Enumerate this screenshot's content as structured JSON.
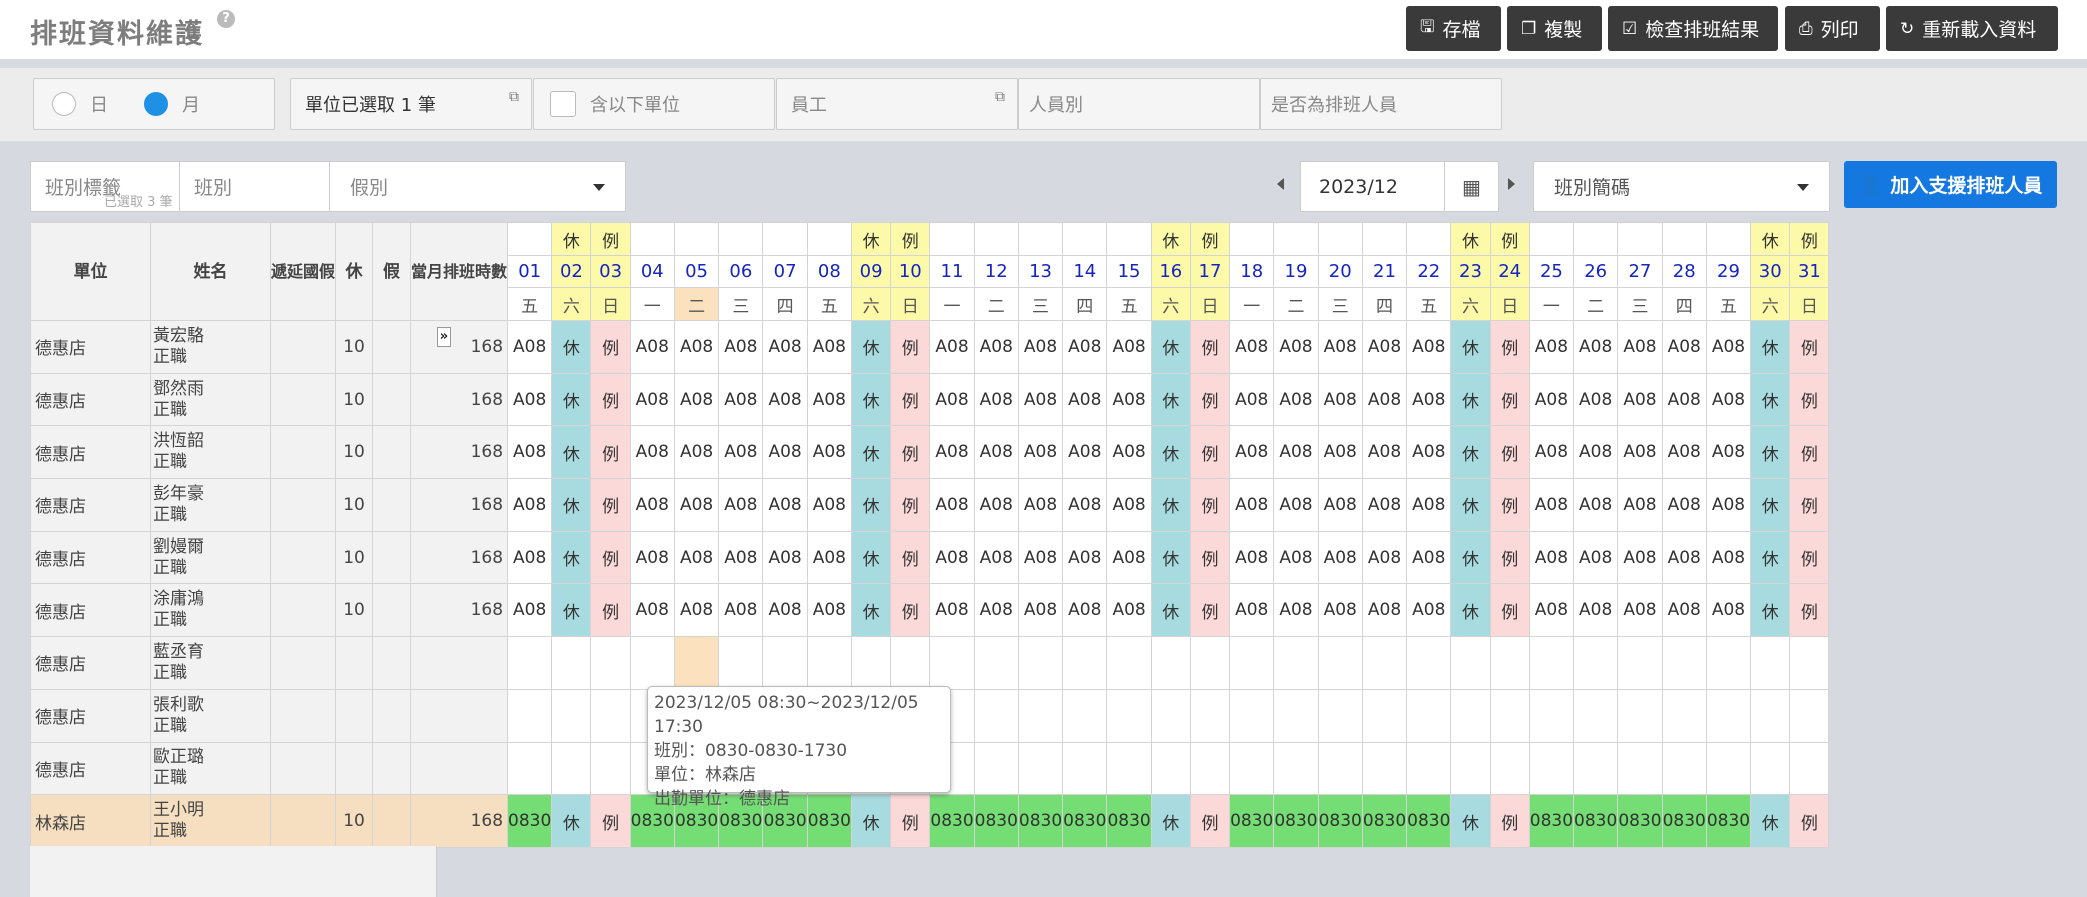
{
  "header": {
    "title": "排班資料維護",
    "help": "?",
    "buttons": [
      {
        "label": "存檔",
        "icon": "save-icon"
      },
      {
        "label": "複製",
        "icon": "copy-icon"
      },
      {
        "label": "檢查排班結果",
        "icon": "check-icon"
      },
      {
        "label": "列印",
        "icon": "print-icon"
      },
      {
        "label": "重新載入資料",
        "icon": "reload-icon"
      }
    ]
  },
  "filters": {
    "mode_day": "日",
    "mode_month": "月",
    "selected_mode": "月",
    "unit_selected": "單位已選取 1 筆",
    "include_sub_units": "含以下單位",
    "employee": "員工",
    "staff_type": "人員別",
    "is_scheduler": "是否為排班人員"
  },
  "grid_filters": {
    "shift_tag": "班別標籤",
    "shift_tag_count": "已選取 3 筆",
    "shift": "班別",
    "leave": "假別",
    "month": "2023/12",
    "shift_code": "班別簡碼",
    "add_support": "加入支援排班人員"
  },
  "table": {
    "headers": {
      "unit": "單位",
      "name": "姓名",
      "deferred": "遞延國假",
      "rest": "休",
      "leave": "假",
      "hours": "當月排班時數"
    },
    "days": [
      {
        "d": "01",
        "w": "五",
        "top": ""
      },
      {
        "d": "02",
        "w": "六",
        "top": "休"
      },
      {
        "d": "03",
        "w": "日",
        "top": "例"
      },
      {
        "d": "04",
        "w": "一",
        "top": ""
      },
      {
        "d": "05",
        "w": "二",
        "top": ""
      },
      {
        "d": "06",
        "w": "三",
        "top": ""
      },
      {
        "d": "07",
        "w": "四",
        "top": ""
      },
      {
        "d": "08",
        "w": "五",
        "top": ""
      },
      {
        "d": "09",
        "w": "六",
        "top": "休"
      },
      {
        "d": "10",
        "w": "日",
        "top": "例"
      },
      {
        "d": "11",
        "w": "一",
        "top": ""
      },
      {
        "d": "12",
        "w": "二",
        "top": ""
      },
      {
        "d": "13",
        "w": "三",
        "top": ""
      },
      {
        "d": "14",
        "w": "四",
        "top": ""
      },
      {
        "d": "15",
        "w": "五",
        "top": ""
      },
      {
        "d": "16",
        "w": "六",
        "top": "休"
      },
      {
        "d": "17",
        "w": "日",
        "top": "例"
      },
      {
        "d": "18",
        "w": "一",
        "top": ""
      },
      {
        "d": "19",
        "w": "二",
        "top": ""
      },
      {
        "d": "20",
        "w": "三",
        "top": ""
      },
      {
        "d": "21",
        "w": "四",
        "top": ""
      },
      {
        "d": "22",
        "w": "五",
        "top": ""
      },
      {
        "d": "23",
        "w": "六",
        "top": "休"
      },
      {
        "d": "24",
        "w": "日",
        "top": "例"
      },
      {
        "d": "25",
        "w": "一",
        "top": ""
      },
      {
        "d": "26",
        "w": "二",
        "top": ""
      },
      {
        "d": "27",
        "w": "三",
        "top": ""
      },
      {
        "d": "28",
        "w": "四",
        "top": ""
      },
      {
        "d": "29",
        "w": "五",
        "top": ""
      },
      {
        "d": "30",
        "w": "六",
        "top": "休"
      },
      {
        "d": "31",
        "w": "日",
        "top": "例"
      }
    ],
    "rows": [
      {
        "unit": "德惠店",
        "name": "黃宏駱",
        "title": "正職",
        "deferred": "",
        "rest": "10",
        "leave": "",
        "hours": "168",
        "shift": "A08"
      },
      {
        "unit": "德惠店",
        "name": "鄧然雨",
        "title": "正職",
        "deferred": "",
        "rest": "10",
        "leave": "",
        "hours": "168",
        "shift": "A08"
      },
      {
        "unit": "德惠店",
        "name": "洪恆韶",
        "title": "正職",
        "deferred": "",
        "rest": "10",
        "leave": "",
        "hours": "168",
        "shift": "A08"
      },
      {
        "unit": "德惠店",
        "name": "彭年豪",
        "title": "正職",
        "deferred": "",
        "rest": "10",
        "leave": "",
        "hours": "168",
        "shift": "A08"
      },
      {
        "unit": "德惠店",
        "name": "劉嫚爾",
        "title": "正職",
        "deferred": "",
        "rest": "10",
        "leave": "",
        "hours": "168",
        "shift": "A08"
      },
      {
        "unit": "德惠店",
        "name": "涂庸鴻",
        "title": "正職",
        "deferred": "",
        "rest": "10",
        "leave": "",
        "hours": "168",
        "shift": "A08"
      },
      {
        "unit": "德惠店",
        "name": "藍丞育",
        "title": "正職",
        "deferred": "",
        "rest": "",
        "leave": "",
        "hours": "",
        "shift": ""
      },
      {
        "unit": "德惠店",
        "name": "張利歌",
        "title": "正職",
        "deferred": "",
        "rest": "",
        "leave": "",
        "hours": "",
        "shift": ""
      },
      {
        "unit": "德惠店",
        "name": "歐正璐",
        "title": "正職",
        "deferred": "",
        "rest": "",
        "leave": "",
        "hours": "",
        "shift": ""
      },
      {
        "unit": "林森店",
        "name": "王小明",
        "title": "正職",
        "deferred": "",
        "rest": "10",
        "leave": "",
        "hours": "168",
        "shift": "0830"
      }
    ],
    "rest_label": "休",
    "off_label": "例"
  },
  "expand_toggle": "»",
  "tooltip": {
    "line1": "2023/12/05 08:30~2023/12/05 17:30",
    "line2": "班別：0830-0830-1730",
    "line3": "單位：林森店",
    "line4": "出勤單位：德惠店"
  },
  "colors": {
    "weekend_header": "#fcf9a8",
    "rest_cell": "#a8dbe0",
    "off_cell": "#fcd9d9",
    "support_shift": "#74dd74",
    "primary_button": "#1478e0",
    "date_text": "#1525c0"
  }
}
